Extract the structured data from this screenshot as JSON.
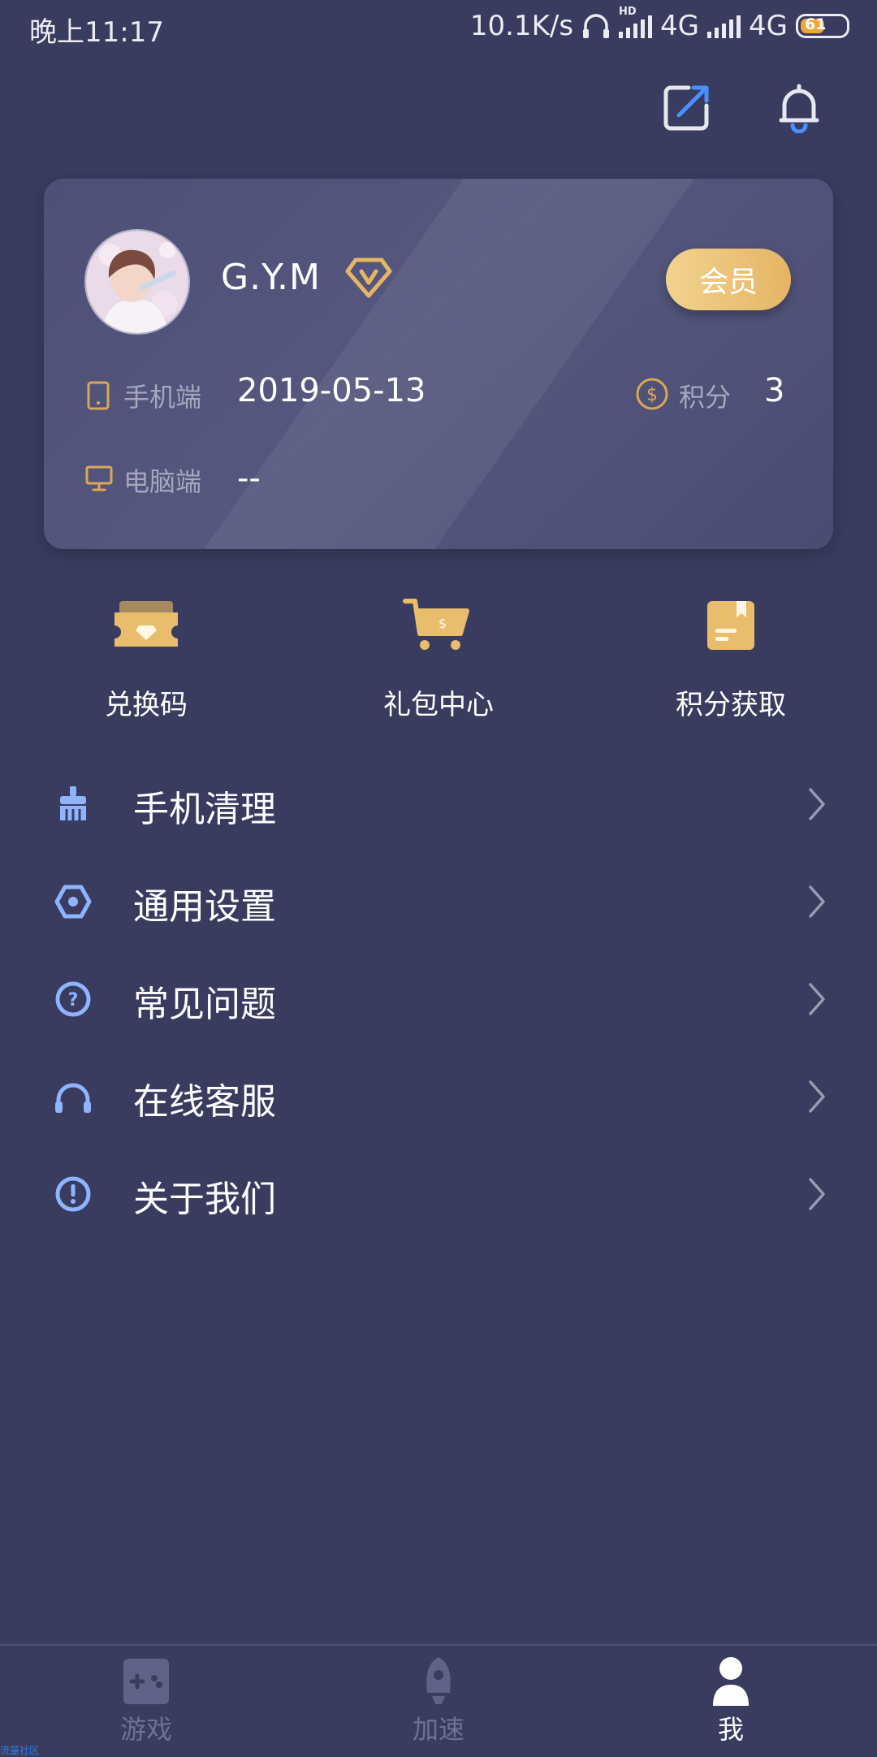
{
  "status_bar": {
    "time": "晚上11:17",
    "speed": "10.1K/s",
    "network1": "4G",
    "network2": "4G",
    "battery": "61",
    "hd": "HD"
  },
  "profile": {
    "username": "G.Y.M",
    "member_button": "会员",
    "mobile_label": "手机端",
    "mobile_value": "2019-05-13",
    "points_label": "积分",
    "points_value": "3",
    "pc_label": "电脑端",
    "pc_value": "--"
  },
  "quick_actions": [
    {
      "label": "兑换码",
      "icon": "ticket-icon"
    },
    {
      "label": "礼包中心",
      "icon": "cart-icon"
    },
    {
      "label": "积分获取",
      "icon": "document-icon"
    }
  ],
  "menu": [
    {
      "label": "手机清理",
      "icon": "broom-icon"
    },
    {
      "label": "通用设置",
      "icon": "settings-icon"
    },
    {
      "label": "常见问题",
      "icon": "question-icon"
    },
    {
      "label": "在线客服",
      "icon": "headset-icon"
    },
    {
      "label": "关于我们",
      "icon": "info-icon"
    }
  ],
  "bottom_nav": [
    {
      "label": "游戏",
      "icon": "gamepad-icon",
      "active": false
    },
    {
      "label": "加速",
      "icon": "rocket-icon",
      "active": false
    },
    {
      "label": "我",
      "icon": "user-icon",
      "active": true
    }
  ],
  "watermark": "流量社区",
  "colors": {
    "background": "#393b5f",
    "accent_gold": "#e8bd6c",
    "menu_icon_blue": "#8fb4ff",
    "inactive_nav": "#6e7096"
  }
}
